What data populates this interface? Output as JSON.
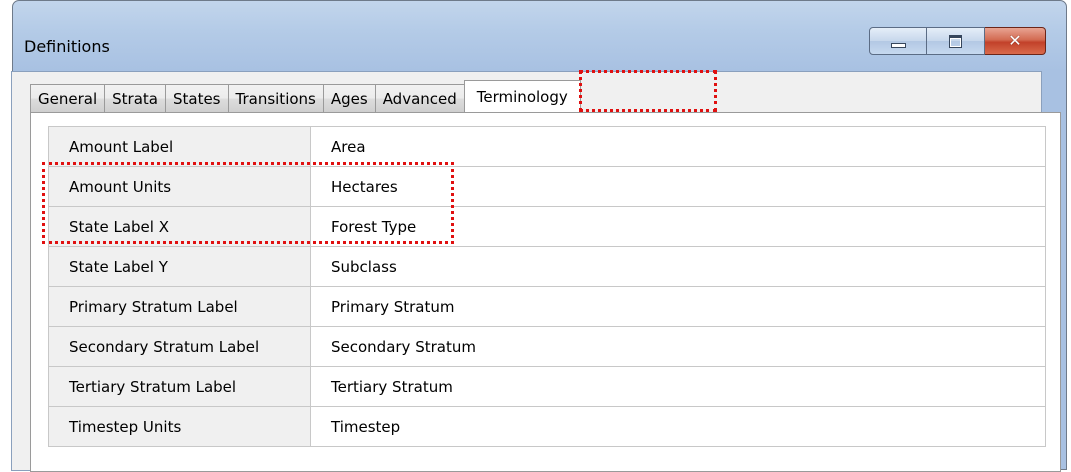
{
  "window": {
    "title": "Definitions",
    "controls": {
      "minimize_icon": "minimize-icon",
      "maximize_icon": "maximize-icon",
      "close_icon": "close-icon",
      "close_glyph": "✕"
    }
  },
  "tabs": [
    {
      "label": "General",
      "active": false
    },
    {
      "label": "Strata",
      "active": false
    },
    {
      "label": "States",
      "active": false
    },
    {
      "label": "Transitions",
      "active": false
    },
    {
      "label": "Ages",
      "active": false
    },
    {
      "label": "Advanced",
      "active": false
    },
    {
      "label": "Terminology",
      "active": true
    }
  ],
  "terminology": {
    "rows": [
      {
        "key": "Amount Label",
        "value": "Area"
      },
      {
        "key": "Amount Units",
        "value": "Hectares"
      },
      {
        "key": "State Label X",
        "value": "Forest Type"
      },
      {
        "key": "State Label Y",
        "value": "Subclass"
      },
      {
        "key": "Primary Stratum Label",
        "value": "Primary Stratum"
      },
      {
        "key": "Secondary Stratum Label",
        "value": "Secondary Stratum"
      },
      {
        "key": "Tertiary Stratum Label",
        "value": "Tertiary Stratum"
      },
      {
        "key": "Timestep Units",
        "value": "Timestep"
      }
    ]
  },
  "colors": {
    "highlight": "#e01010",
    "title_bar": "#b4cbe7",
    "close_button": "#c2412a"
  }
}
